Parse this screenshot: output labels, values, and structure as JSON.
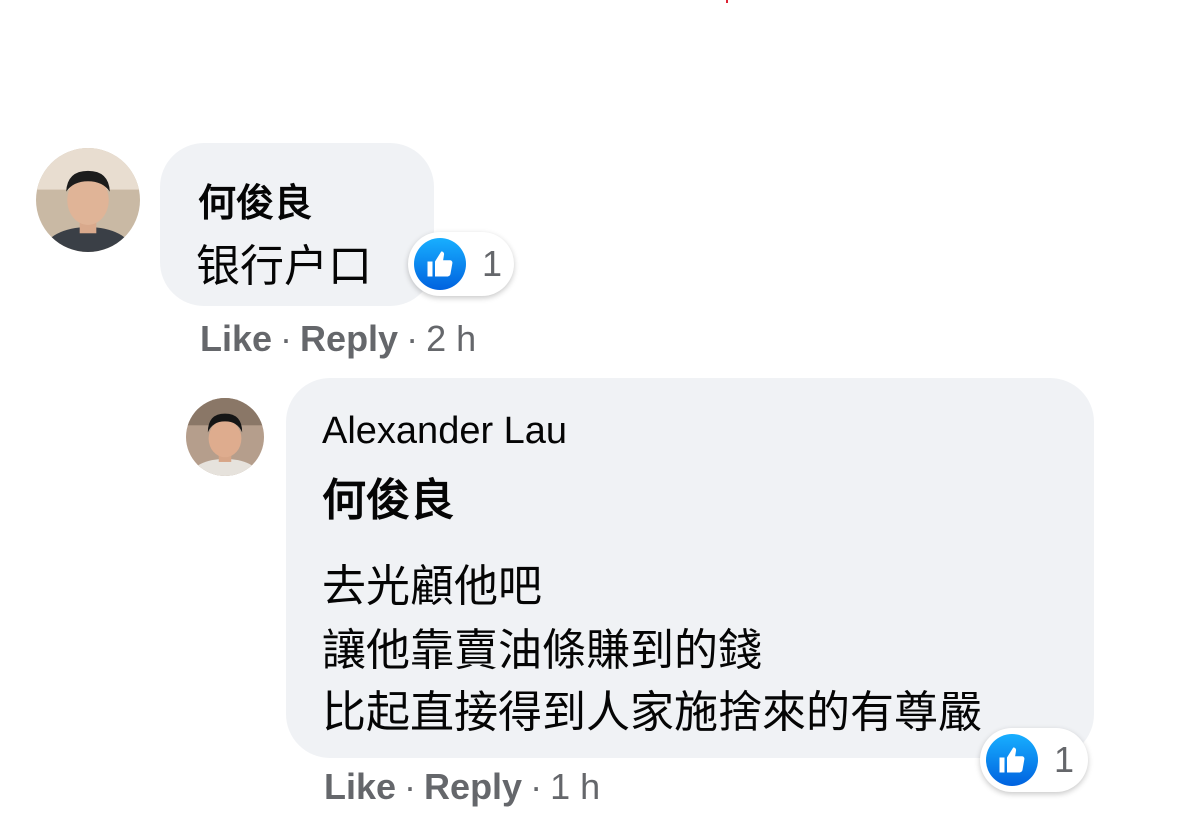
{
  "comments": [
    {
      "author": "何俊良",
      "lines": [
        "银行户口"
      ],
      "reaction_count": "1",
      "like_label": "Like",
      "reply_label": "Reply",
      "separator": "·",
      "time": "2 h"
    },
    {
      "author": "Alexander Lau",
      "mention": "何俊良",
      "lines": [
        "去光顧他吧",
        "讓他靠賣油條賺到的錢",
        "比起直接得到人家施捨來的有尊嚴"
      ],
      "reaction_count": "1",
      "like_label": "Like",
      "reply_label": "Reply",
      "separator": "·",
      "time": "1 h"
    }
  ],
  "colors": {
    "bubble_bg": "#f0f2f5",
    "like_blue": "#1877f2",
    "meta_gray": "#65676b"
  },
  "icons": [
    "thumbs-up-icon"
  ]
}
